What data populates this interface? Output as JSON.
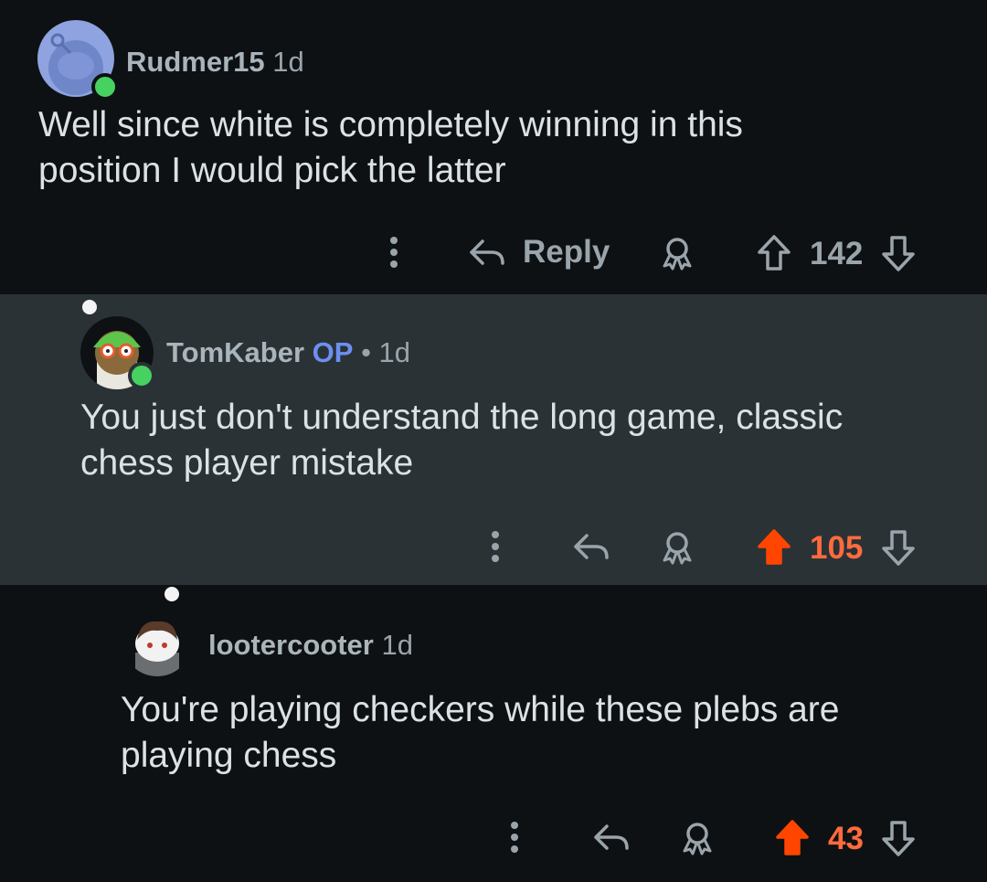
{
  "colors": {
    "upvoted": "#ff4500",
    "online": "#46d160",
    "op": "#6d8ff0"
  },
  "comments": [
    {
      "username": "Rudmer15",
      "time": "1d",
      "body_line1": "Well since white is completely winning in this",
      "body_line2": "position I would pick the latter",
      "reply_label": "Reply",
      "score": "142",
      "upvoted": false
    },
    {
      "username": "TomKaber",
      "op_badge": "OP",
      "separator": "•",
      "time": "1d",
      "body_line1": "You just don't understand the long game, classic",
      "body_line2": "chess player mistake",
      "score": "105",
      "upvoted": true
    },
    {
      "username": "lootercooter",
      "time": "1d",
      "body_line1": "You're playing checkers while these plebs are",
      "body_line2": "playing chess",
      "score": "43",
      "upvoted": true
    }
  ],
  "icons": {
    "more": "more-vertical-icon",
    "reply": "reply-arrow-icon",
    "award": "award-icon",
    "upvote": "upvote-arrow-icon",
    "downvote": "downvote-arrow-icon"
  }
}
